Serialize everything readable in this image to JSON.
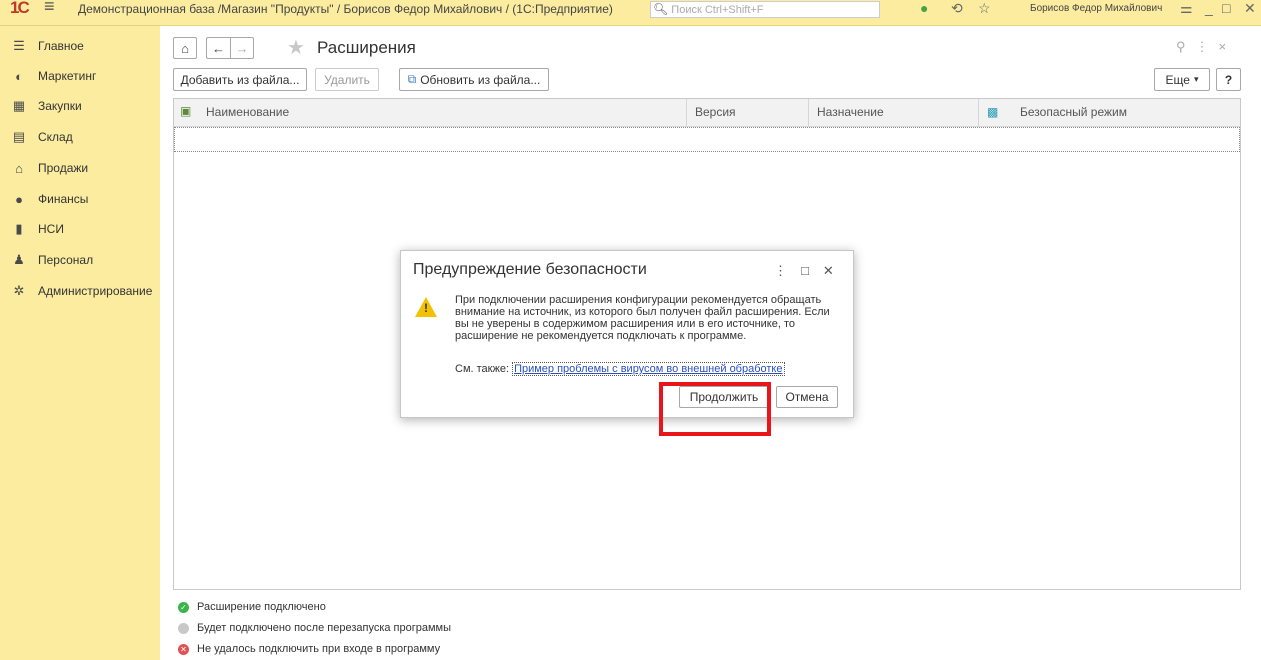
{
  "titlebar": {
    "logo": "1С",
    "title": "Демонстрационная база /Магазин \"Продукты\" / Борисов Федор Михайлович / (1С:Предприятие)",
    "search_placeholder": "Поиск Ctrl+Shift+F",
    "user": "Борисов Федор Михайлович"
  },
  "sidebar": {
    "items": [
      {
        "label": "Главное",
        "icon": "menu-icon"
      },
      {
        "label": "Маркетинг",
        "icon": "marketing-icon"
      },
      {
        "label": "Закупки",
        "icon": "purchases-icon"
      },
      {
        "label": "Склад",
        "icon": "warehouse-icon"
      },
      {
        "label": "Продажи",
        "icon": "sales-icon"
      },
      {
        "label": "Финансы",
        "icon": "finance-icon"
      },
      {
        "label": "НСИ",
        "icon": "reference-icon"
      },
      {
        "label": "Персонал",
        "icon": "person-icon"
      },
      {
        "label": "Администрирование",
        "icon": "gear-icon"
      }
    ]
  },
  "header": {
    "title": "Расширения"
  },
  "toolbar": {
    "add_label": "Добавить из файла...",
    "delete_label": "Удалить",
    "update_label": "Обновить из файла...",
    "more_label": "Еще",
    "help_label": "?"
  },
  "table": {
    "columns": [
      "Наименование",
      "Версия",
      "Назначение",
      "Безопасный режим"
    ],
    "rows": []
  },
  "dialog": {
    "title": "Предупреждение безопасности",
    "text": "При подключении расширения конфигурации рекомендуется обращать внимание на источник, из которого был получен файл расширения. Если вы не уверены в содержимом расширения или в его источнике, то расширение не рекомендуется подключать к программе.",
    "see_also_label": "См. также:",
    "see_also_link": "Пример проблемы с вирусом во внешней обработке",
    "continue_label": "Продолжить",
    "cancel_label": "Отмена"
  },
  "legend": [
    {
      "label": "Расширение подключено",
      "color": "#3bb54a"
    },
    {
      "label": "Будет подключено после перезапуска программы",
      "color": "#c8c8c8"
    },
    {
      "label": "Не удалось подключить при входе в программу",
      "color": "#e05252"
    }
  ]
}
